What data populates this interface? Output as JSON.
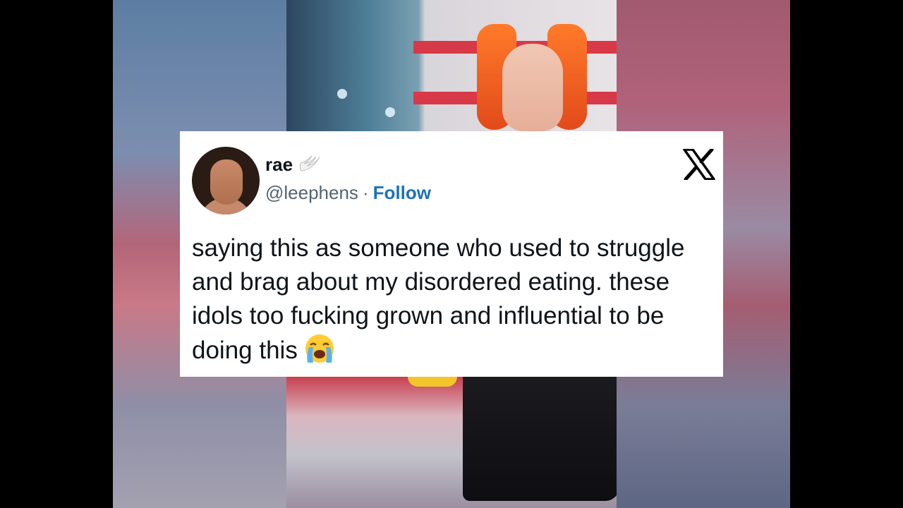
{
  "tweet": {
    "display_name": "rae",
    "name_emoji_icon": "wing-icon",
    "handle": "@leephens",
    "separator": "·",
    "follow_label": "Follow",
    "text": "saying this as someone who used to struggle and brag about my disordered eating. these idols too fucking grown and influential to be doing this",
    "trailing_emoji_icon": "loudly-crying-face-icon",
    "platform_logo_icon": "x-logo-icon"
  },
  "colors": {
    "follow_link": "#1d72b8",
    "handle_text": "#536471",
    "body_text": "#0f1419",
    "card_background": "#ffffff"
  }
}
